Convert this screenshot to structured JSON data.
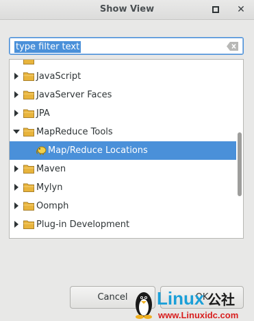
{
  "window": {
    "title": "Show View"
  },
  "filter": {
    "value": "type filter text"
  },
  "tree": {
    "items": [
      {
        "label": "JavaScript",
        "expanded": false,
        "icon": "folder-icon"
      },
      {
        "label": "JavaServer Faces",
        "expanded": false,
        "icon": "folder-icon"
      },
      {
        "label": "JPA",
        "expanded": false,
        "icon": "folder-icon"
      },
      {
        "label": "MapReduce Tools",
        "expanded": true,
        "icon": "folder-icon"
      },
      {
        "label": "Map/Reduce Locations",
        "selected": true,
        "icon": "elephant-icon"
      },
      {
        "label": "Maven",
        "expanded": false,
        "icon": "folder-icon"
      },
      {
        "label": "Mylyn",
        "expanded": false,
        "icon": "folder-icon"
      },
      {
        "label": "Oomph",
        "expanded": false,
        "icon": "folder-icon"
      },
      {
        "label": "Plug-in Development",
        "expanded": false,
        "icon": "folder-icon"
      }
    ]
  },
  "buttons": {
    "cancel": "Cancel",
    "ok": "OK"
  },
  "watermark": {
    "brand": "Linux",
    "suffix": "公社",
    "url": "www.Linuxidc.com"
  },
  "colors": {
    "selection": "#4a90d9",
    "folder": "#e8b43c"
  }
}
